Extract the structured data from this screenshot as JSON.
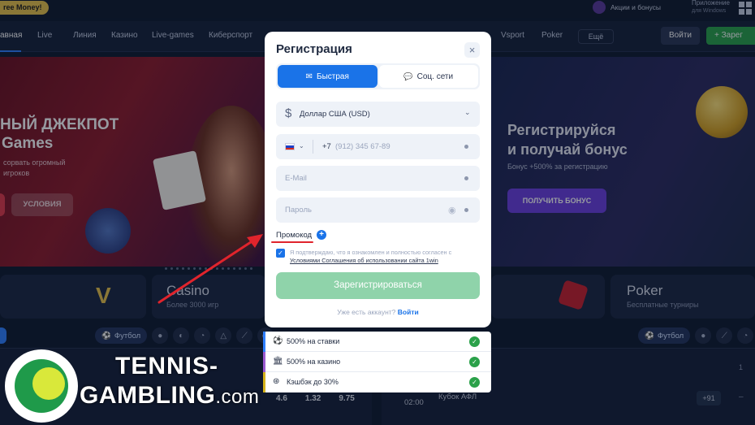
{
  "topbar": {
    "free_money": "ree Money!",
    "promos_bonuses": "Акции и бонусы",
    "app_title": "Приложение",
    "app_sub": "для Windows"
  },
  "nav": {
    "items": [
      "авная",
      "Live",
      "Линия",
      "Казино",
      "Live-games",
      "Киберспорт",
      "Vsport",
      "Poker"
    ],
    "more": "Ещё",
    "login": "Войти",
    "register": "Зарег"
  },
  "hero_left": {
    "title_line1": "НЫЙ ДЖЕКПОТ",
    "title_line2": "Games",
    "desc_line1": "сорвать огромный",
    "desc_line2": "игроков",
    "terms_button": "УСЛОВИЯ"
  },
  "hero_right": {
    "title_line1": "Регистрируйся",
    "title_line2": "и получай бонус",
    "subtitle": "Бонус +500% за регистрацию",
    "cta": "ПОЛУЧИТЬ БОНУС"
  },
  "categories": {
    "casino_title": "Casino",
    "casino_sub": "Более 3000 игр",
    "poker_title": "Poker",
    "poker_sub": "Бесплатные турниры"
  },
  "sports": {
    "football": "Футбол"
  },
  "table_left": {
    "odds": [
      "4.6",
      "1.32",
      "9.75"
    ]
  },
  "table_right": {
    "time": "02:00",
    "league": "Кубок АФЛ",
    "more_markets": "+91",
    "col_one": "1",
    "dash": "–"
  },
  "modal": {
    "title": "Регистрация",
    "close": "×",
    "tabs": [
      {
        "label": "Быстрая",
        "icon": "envelope-icon",
        "active": true
      },
      {
        "label": "Соц. сети",
        "icon": "chat-icon",
        "active": false
      }
    ],
    "currency": "Доллар США (USD)",
    "phone_code": "+7",
    "phone_placeholder": "(912) 345 67-89",
    "email_placeholder": "E-Mail",
    "password_placeholder": "Пароль",
    "promo_label": "Промокод",
    "consent_text": "Я подтверждаю, что я ознакомлен и полностью согласен с ",
    "consent_link": "Условиями Соглашения об использовании сайта 1win",
    "submit": "Зарегистрироваться",
    "have_account": "Уже есть аккаунт?",
    "login_link": "Войти"
  },
  "bonuses": [
    {
      "text": "500% на ставки",
      "color": "#2f80ff",
      "icon": "soccer-ball-icon"
    },
    {
      "text": "500% на казино",
      "color": "#9b59d0",
      "icon": "casino-icon"
    },
    {
      "text": "Кэшбэк до 30%",
      "color": "#d4b21a",
      "icon": "cashback-icon"
    }
  ],
  "watermark": {
    "line1": "TENNIS-",
    "line2": "GAMBLING",
    "domain": ".com"
  },
  "colors": {
    "accent": "#1a73e8",
    "submit_green": "#8fd3aa",
    "check_green": "#2ba14a",
    "annotation_red": "#e0242c"
  }
}
